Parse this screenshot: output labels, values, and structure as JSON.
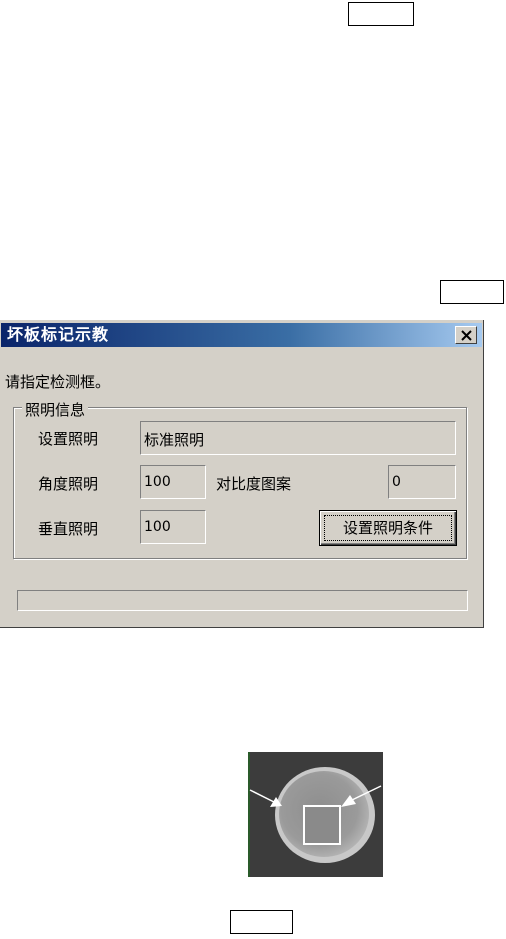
{
  "dialog": {
    "title": "坏板标记示教",
    "prompt": "请指定检测框。",
    "group_title": "照明信息",
    "setting_label": "设置照明",
    "setting_value": "标准照明",
    "angle_label": "角度照明",
    "angle_value": "100",
    "contrast_label": "对比度图案",
    "contrast_value": "0",
    "vertical_label": "垂直照明",
    "vertical_value": "100",
    "set_button_label": "设置照明条件"
  },
  "icons": {
    "close": "close-icon"
  },
  "colors": {
    "titlebar_start": "#0a246a",
    "titlebar_end": "#a6caf0",
    "dialog_bg": "#d4d0c8"
  }
}
